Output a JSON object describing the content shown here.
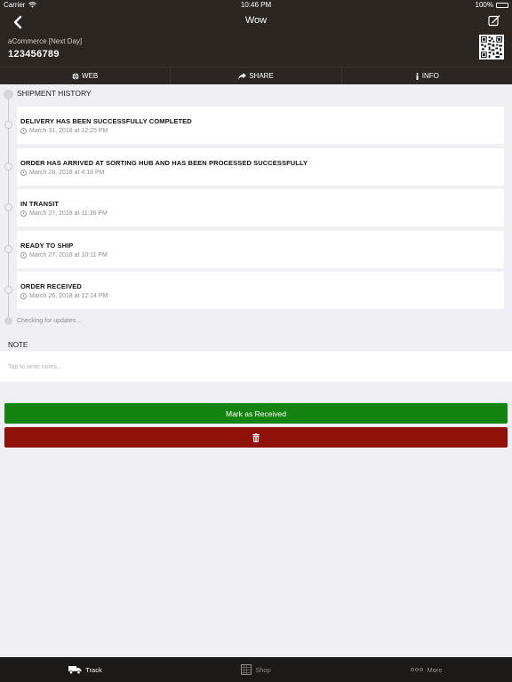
{
  "status_bar": {
    "carrier": "Carrier",
    "time": "10:46 PM",
    "battery": "100%"
  },
  "nav": {
    "title": "Wow",
    "subtitle": "aCommerce [Next Day]",
    "tracking_number": "123456789",
    "back_icon": "chevron-left-icon",
    "edit_icon": "edit-icon"
  },
  "actions": [
    {
      "label": "WEB",
      "icon": "globe-icon"
    },
    {
      "label": "SHARE",
      "icon": "share-icon"
    },
    {
      "label": "INFO",
      "icon": "info-icon"
    }
  ],
  "history": {
    "header": "SHIPMENT HISTORY",
    "events": [
      {
        "title": "DELIVERY HAS BEEN SUCCESSFULLY COMPLETED",
        "date": "March 31, 2018 at 12:25 PM"
      },
      {
        "title": "ORDER HAS ARRIVED AT SORTING HUB AND HAS BEEN PROCESSED SUCCESSFULLY",
        "date": "March 28, 2018 at 4:18 PM"
      },
      {
        "title": "IN TRANSIT",
        "date": "March 27, 2018 at 11:36 PM"
      },
      {
        "title": "READY TO SHIP",
        "date": "March 27, 2018 at 10:11 PM"
      },
      {
        "title": "ORDER RECEIVED",
        "date": "March 26, 2018 at 12:14 PM"
      }
    ],
    "checking": "Checking for updates..."
  },
  "note": {
    "label": "NOTE",
    "placeholder": "Tap to write notes..."
  },
  "buttons": {
    "mark_received": "Mark as Received",
    "delete_icon": "trash-icon"
  },
  "tabs": [
    {
      "label": "Track",
      "icon": "truck-icon",
      "active": true
    },
    {
      "label": "Shop",
      "icon": "shop-icon",
      "active": false
    },
    {
      "label": "More",
      "icon": "more-icon",
      "active": false
    }
  ],
  "colors": {
    "nav_bg": "#2b2622",
    "green": "#138410",
    "red": "#8e1208",
    "tab_bg": "#1c1a18"
  }
}
